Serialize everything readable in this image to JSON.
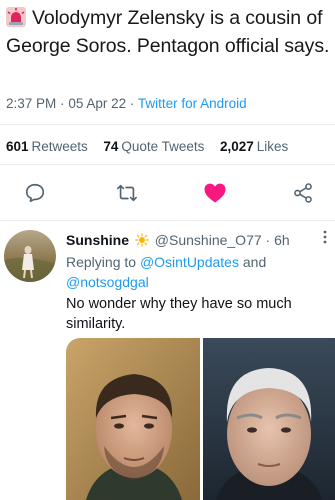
{
  "tweet": {
    "siren_icon": "rotating-light-icon",
    "text": "Volodymyr Zelensky is a cousin of George Soros. Pentagon official says.",
    "time": "2:37 PM",
    "date": "05 Apr 22",
    "source": "Twitter for Android",
    "separator": "·"
  },
  "stats": {
    "retweets_count": "601",
    "retweets_label": "Retweets",
    "quotes_count": "74",
    "quotes_label": "Quote Tweets",
    "likes_count": "2,027",
    "likes_label": "Likes"
  },
  "actions": {
    "reply_icon": "speech-bubble-icon",
    "retweet_icon": "retweet-icon",
    "like_icon": "heart-icon",
    "share_icon": "share-icon",
    "like_color": "#f91880"
  },
  "reply": {
    "display_name": "Sunshine",
    "emoji": "sun-icon",
    "handle": "@Sunshine_O77",
    "separator": "·",
    "age": "6h",
    "replying_prefix": "Replying to",
    "mention_1": "@OsintUpdates",
    "and_word": "and",
    "mention_2": "@notsogdgal",
    "text": "No wonder why they have so much similarity.",
    "more_icon": "more-vertical-icon"
  },
  "colors": {
    "link": "#1d9bf0",
    "muted": "#536471",
    "text": "#0f1419"
  }
}
